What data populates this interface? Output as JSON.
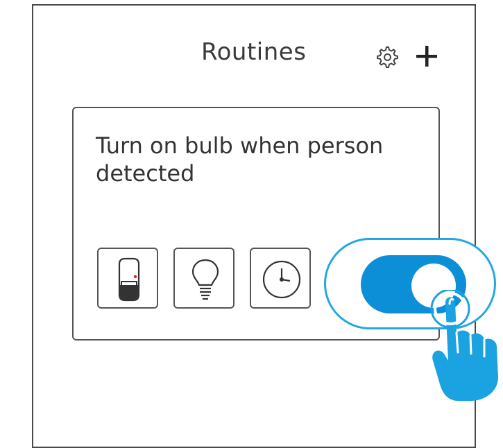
{
  "header": {
    "title": "Routines",
    "icons": [
      "gear-icon",
      "plus-icon"
    ]
  },
  "routine": {
    "title": "Turn on bulb when person detected",
    "device_icons": [
      "motion-sensor-icon",
      "light-bulb-icon",
      "clock-icon"
    ],
    "toggle_state": "on"
  },
  "colors": {
    "accent": "#0d8fd8",
    "ring": "#22a7e2",
    "hand": "#1aa3e0",
    "sensor_dot": "#e0242a"
  }
}
